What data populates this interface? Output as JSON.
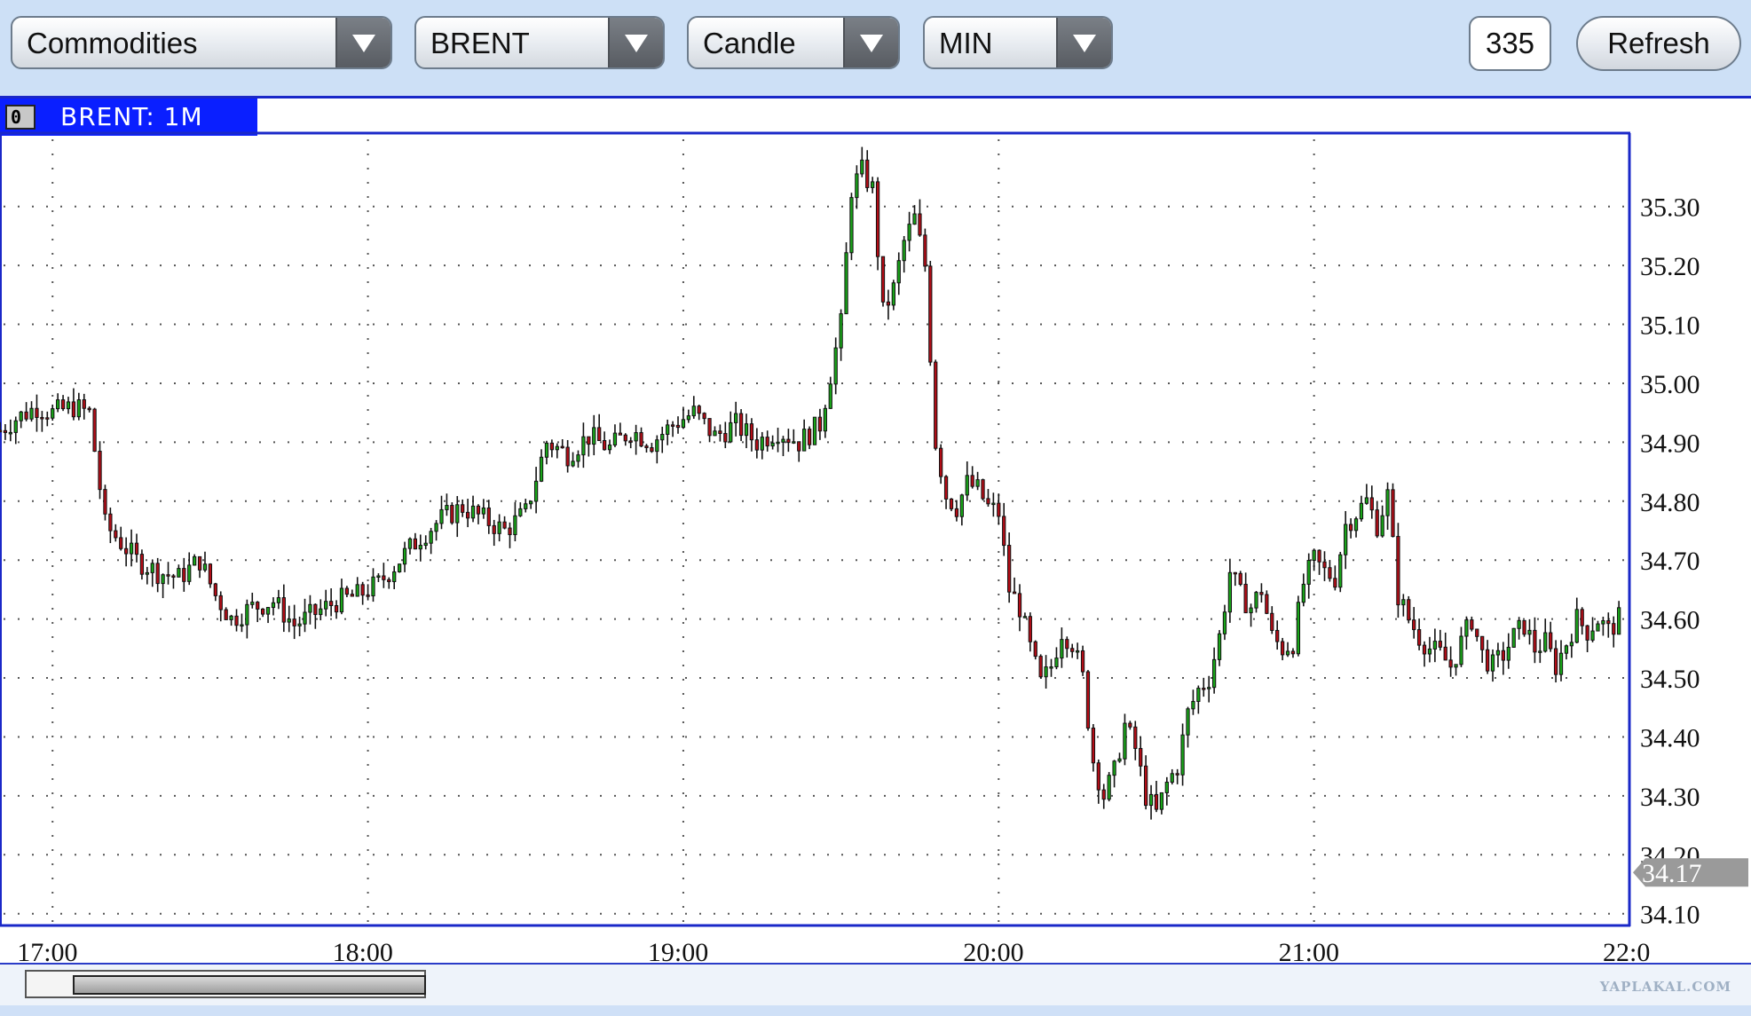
{
  "toolbar": {
    "market_select": "Commodities",
    "symbol_select": "BRENT",
    "chart_type_select": "Candle",
    "interval_select": "MIN",
    "count_value": "335",
    "refresh_label": "Refresh"
  },
  "chart_header": {
    "toggle_label": "0",
    "title": "BRENT: 1M"
  },
  "watermark": "YAPLAKAL.COM",
  "colors": {
    "up": "#19a519",
    "down": "#b30d17",
    "frame": "#1a28c8",
    "tab_bg": "#0a1fff",
    "price_tag_bg": "#9a9a9a"
  },
  "chart_data": {
    "type": "candlestick",
    "title": "BRENT: 1M",
    "xlabel": "",
    "ylabel": "",
    "x_ticks": [
      "17:00",
      "18:00",
      "19:00",
      "20:00",
      "21:00",
      "22:0"
    ],
    "y_ticks": [
      "35.30",
      "35.20",
      "35.10",
      "35.00",
      "34.90",
      "34.80",
      "34.70",
      "34.60",
      "34.50",
      "34.40",
      "34.30",
      "34.20",
      "34.10"
    ],
    "ylim": [
      34.08,
      35.42
    ],
    "x_range_minutes": [
      -10,
      300
    ],
    "grid": true,
    "last_price": "34.17",
    "series": [
      {
        "name": "BRENT",
        "close_path": [
          [
            -10,
            34.92
          ],
          [
            -7,
            34.94
          ],
          [
            -3,
            34.96
          ],
          [
            0,
            34.95
          ],
          [
            4,
            34.96
          ],
          [
            7,
            34.95
          ],
          [
            10,
            34.76
          ],
          [
            13,
            34.73
          ],
          [
            16,
            34.7
          ],
          [
            20,
            34.68
          ],
          [
            24,
            34.67
          ],
          [
            28,
            34.7
          ],
          [
            31,
            34.64
          ],
          [
            34,
            34.6
          ],
          [
            38,
            34.62
          ],
          [
            42,
            34.63
          ],
          [
            46,
            34.59
          ],
          [
            50,
            34.61
          ],
          [
            54,
            34.63
          ],
          [
            58,
            34.64
          ],
          [
            62,
            34.66
          ],
          [
            66,
            34.7
          ],
          [
            70,
            34.74
          ],
          [
            74,
            34.77
          ],
          [
            78,
            34.79
          ],
          [
            82,
            34.77
          ],
          [
            86,
            34.75
          ],
          [
            90,
            34.78
          ],
          [
            94,
            34.9
          ],
          [
            98,
            34.88
          ],
          [
            102,
            34.91
          ],
          [
            106,
            34.89
          ],
          [
            110,
            34.92
          ],
          [
            114,
            34.9
          ],
          [
            118,
            34.93
          ],
          [
            122,
            34.95
          ],
          [
            126,
            34.91
          ],
          [
            130,
            34.93
          ],
          [
            134,
            34.9
          ],
          [
            138,
            34.92
          ],
          [
            142,
            34.9
          ],
          [
            146,
            34.93
          ],
          [
            150,
            35.1
          ],
          [
            152,
            35.33
          ],
          [
            154,
            35.36
          ],
          [
            156,
            35.33
          ],
          [
            158,
            35.12
          ],
          [
            160,
            35.16
          ],
          [
            162,
            35.24
          ],
          [
            164,
            35.28
          ],
          [
            166,
            35.2
          ],
          [
            168,
            34.9
          ],
          [
            170,
            34.81
          ],
          [
            172,
            34.79
          ],
          [
            174,
            34.83
          ],
          [
            176,
            34.82
          ],
          [
            178,
            34.79
          ],
          [
            180,
            34.78
          ],
          [
            182,
            34.65
          ],
          [
            184,
            34.62
          ],
          [
            186,
            34.55
          ],
          [
            188,
            34.49
          ],
          [
            190,
            34.52
          ],
          [
            192,
            34.58
          ],
          [
            194,
            34.56
          ],
          [
            196,
            34.5
          ],
          [
            198,
            34.36
          ],
          [
            200,
            34.3
          ],
          [
            202,
            34.34
          ],
          [
            204,
            34.42
          ],
          [
            206,
            34.38
          ],
          [
            208,
            34.3
          ],
          [
            210,
            34.27
          ],
          [
            212,
            34.32
          ],
          [
            214,
            34.35
          ],
          [
            216,
            34.44
          ],
          [
            218,
            34.48
          ],
          [
            220,
            34.5
          ],
          [
            222,
            34.57
          ],
          [
            224,
            34.68
          ],
          [
            226,
            34.64
          ],
          [
            228,
            34.62
          ],
          [
            230,
            34.65
          ],
          [
            232,
            34.57
          ],
          [
            234,
            34.55
          ],
          [
            236,
            34.56
          ],
          [
            238,
            34.66
          ],
          [
            240,
            34.7
          ],
          [
            242,
            34.68
          ],
          [
            244,
            34.67
          ],
          [
            246,
            34.76
          ],
          [
            248,
            34.78
          ],
          [
            250,
            34.8
          ],
          [
            252,
            34.76
          ],
          [
            254,
            34.81
          ],
          [
            256,
            34.64
          ],
          [
            258,
            34.6
          ],
          [
            260,
            34.57
          ],
          [
            262,
            34.55
          ],
          [
            264,
            34.54
          ],
          [
            266,
            34.52
          ],
          [
            268,
            34.56
          ],
          [
            270,
            34.6
          ],
          [
            272,
            34.54
          ],
          [
            274,
            34.52
          ],
          [
            276,
            34.54
          ],
          [
            278,
            34.57
          ],
          [
            280,
            34.59
          ],
          [
            282,
            34.55
          ],
          [
            284,
            34.56
          ],
          [
            286,
            34.52
          ],
          [
            288,
            34.56
          ],
          [
            290,
            34.6
          ],
          [
            292,
            34.58
          ],
          [
            294,
            34.6
          ],
          [
            296,
            34.58
          ],
          [
            298,
            34.6
          ]
        ]
      }
    ]
  }
}
